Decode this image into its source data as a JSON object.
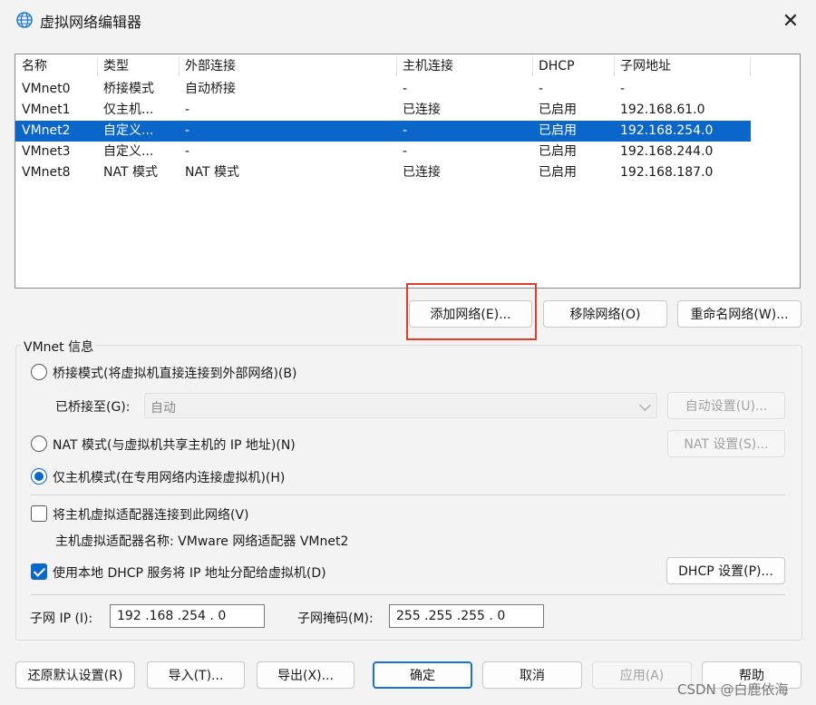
{
  "window": {
    "title": "虚拟网络编辑器",
    "icon": "globe-icon",
    "close_symbol": "✕"
  },
  "network_list": {
    "columns": [
      "名称",
      "类型",
      "外部连接",
      "主机连接",
      "DHCP",
      "子网地址"
    ],
    "rows": [
      [
        "VMnet0",
        "桥接模式",
        "自动桥接",
        "-",
        "-",
        "-"
      ],
      [
        "VMnet1",
        "仅主机...",
        "-",
        "已连接",
        "已启用",
        "192.168.61.0"
      ],
      [
        "VMnet2",
        "自定义...",
        "-",
        "-",
        "已启用",
        "192.168.254.0"
      ],
      [
        "VMnet3",
        "自定义...",
        "-",
        "-",
        "已启用",
        "192.168.244.0"
      ],
      [
        "VMnet8",
        "NAT 模式",
        "NAT 模式",
        "已连接",
        "已启用",
        "192.168.187.0"
      ]
    ],
    "selected_row": 2
  },
  "list_buttons": {
    "add": "添加网络(E)...",
    "remove": "移除网络(O)",
    "rename": "重命名网络(W)..."
  },
  "vmnet_info": {
    "title": "VMnet 信息",
    "bridged_label": "桥接模式(将虚拟机直接连接到外部网络)(B)",
    "bridged_to_label": "已桥接至(G):",
    "bridged_to_value": "自动",
    "auto_settings": "自动设置(U)...",
    "nat_label": "NAT 模式(与虚拟机共享主机的 IP 地址)(N)",
    "nat_settings": "NAT 设置(S)...",
    "hostonly_label": "仅主机模式(在专用网络内连接虚拟机)(H)",
    "selected_mode": "hostonly",
    "connect_adapter_label": "将主机虚拟适配器连接到此网络(V)",
    "connect_adapter_checked": false,
    "adapter_name_label": "主机虚拟适配器名称: VMware 网络适配器 VMnet2",
    "dhcp_label": "使用本地 DHCP 服务将 IP 地址分配给虚拟机(D)",
    "dhcp_checked": true,
    "dhcp_settings": "DHCP 设置(P)...",
    "subnet_ip_label": "子网 IP (I):",
    "subnet_ip_value": "192 .168 .254 .  0",
    "subnet_mask_label": "子网掩码(M):",
    "subnet_mask_value": "255 .255 .255 .  0"
  },
  "footer": {
    "restore": "还原默认设置(R)",
    "import": "导入(T)...",
    "export": "导出(X)...",
    "ok": "确定",
    "cancel": "取消",
    "apply": "应用(A)",
    "help": "帮助"
  },
  "watermark": "CSDN @白鹿依海",
  "colors": {
    "accent": "#0a66c8",
    "highlight_box": "#e53b2e"
  }
}
